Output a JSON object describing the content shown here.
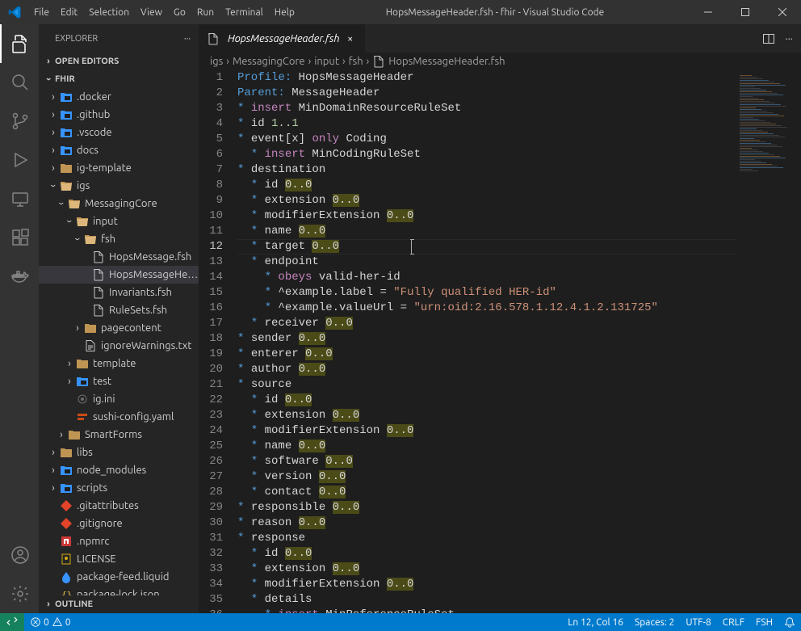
{
  "menu": {
    "file": "File",
    "edit": "Edit",
    "selection": "Selection",
    "view": "View",
    "go": "Go",
    "run": "Run",
    "terminal": "Terminal",
    "help": "Help"
  },
  "window_title": "HopsMessageHeader.fsh - fhir - Visual Studio Code",
  "explorer": {
    "title": "EXPLORER",
    "open_editors": "OPEN EDITORS",
    "root_folder": "FHIR",
    "outline": "OUTLINE",
    "tree": [
      {
        "label": ".docker",
        "depth": 1,
        "type": "folder-special",
        "collapsed": true
      },
      {
        "label": ".github",
        "depth": 1,
        "type": "folder-special",
        "collapsed": true
      },
      {
        "label": ".vscode",
        "depth": 1,
        "type": "folder-special",
        "collapsed": true
      },
      {
        "label": "docs",
        "depth": 1,
        "type": "folder-special",
        "collapsed": true
      },
      {
        "label": "ig-template",
        "depth": 1,
        "type": "folder",
        "collapsed": true
      },
      {
        "label": "igs",
        "depth": 1,
        "type": "folder",
        "collapsed": false
      },
      {
        "label": "MessagingCore",
        "depth": 2,
        "type": "folder",
        "collapsed": false
      },
      {
        "label": "input",
        "depth": 3,
        "type": "folder",
        "collapsed": false
      },
      {
        "label": "fsh",
        "depth": 4,
        "type": "folder",
        "collapsed": false
      },
      {
        "label": "HopsMessage.fsh",
        "depth": 5,
        "type": "file"
      },
      {
        "label": "HopsMessageHea...",
        "depth": 5,
        "type": "file",
        "selected": true
      },
      {
        "label": "Invariants.fsh",
        "depth": 5,
        "type": "file"
      },
      {
        "label": "RuleSets.fsh",
        "depth": 5,
        "type": "file"
      },
      {
        "label": "pagecontent",
        "depth": 4,
        "type": "folder",
        "collapsed": true
      },
      {
        "label": "ignoreWarnings.txt",
        "depth": 4,
        "type": "file-txt"
      },
      {
        "label": "template",
        "depth": 3,
        "type": "folder",
        "collapsed": true
      },
      {
        "label": "test",
        "depth": 3,
        "type": "folder-special",
        "collapsed": true
      },
      {
        "label": "ig.ini",
        "depth": 3,
        "type": "file-cog"
      },
      {
        "label": "sushi-config.yaml",
        "depth": 3,
        "type": "file-yaml"
      },
      {
        "label": "SmartForms",
        "depth": 2,
        "type": "folder",
        "collapsed": true
      },
      {
        "label": "libs",
        "depth": 1,
        "type": "folder",
        "collapsed": true
      },
      {
        "label": "node_modules",
        "depth": 1,
        "type": "folder-special",
        "collapsed": true
      },
      {
        "label": "scripts",
        "depth": 1,
        "type": "folder-special",
        "collapsed": true
      },
      {
        "label": ".gitattributes",
        "depth": 1,
        "type": "file-git"
      },
      {
        "label": ".gitignore",
        "depth": 1,
        "type": "file-git"
      },
      {
        "label": ".npmrc",
        "depth": 1,
        "type": "file-npm"
      },
      {
        "label": "LICENSE",
        "depth": 1,
        "type": "file-cert"
      },
      {
        "label": "package-feed.liquid",
        "depth": 1,
        "type": "file-liquid"
      },
      {
        "label": "package-lock.json",
        "depth": 1,
        "type": "file-json"
      }
    ]
  },
  "tab": {
    "label": "HopsMessageHeader.fsh"
  },
  "breadcrumbs": [
    "igs",
    "MessagingCore",
    "input",
    "fsh",
    "HopsMessageHeader.fsh"
  ],
  "editor": {
    "current_line": 12,
    "total_lines": 36
  },
  "status": {
    "errors": "0",
    "warnings": "0",
    "ln_col": "Ln 12, Col 16",
    "spaces": "Spaces: 2",
    "encoding": "UTF-8",
    "eol": "CRLF",
    "lang": "FSH"
  },
  "tokens": {
    "profile_kw": "Profile:",
    "profile_val": " HopsMessageHeader",
    "parent_kw": "Parent:",
    "parent_val": " MessageHeader",
    "insert": "insert",
    "min_rs": " MinDomainResourceRuleSet",
    "id": "id ",
    "id_card": "1..1",
    "event": "event[x] ",
    "only": "only",
    "coding": " Coding",
    "min_coding": " MinCodingRuleSet",
    "destination": "destination",
    "card00": "0..0",
    "extension": "extension ",
    "modext": "modifierExtension ",
    "name": "name ",
    "target": "target ",
    "endpoint": "endpoint",
    "obeys": "obeys",
    "valid_her": " valid-her-id",
    "ex_label_key": "^example.label",
    "eq": " = ",
    "full_her": "\"Fully qualified HER-id\"",
    "ex_val_key": "^example.valueUrl",
    "urn": "\"urn:oid:2.16.578.1.12.4.1.2.131725\"",
    "receiver": "receiver ",
    "sender": "sender ",
    "enterer": "enterer ",
    "author": "author ",
    "source": "source",
    "software": "software ",
    "version": "version ",
    "contact": "contact ",
    "responsible": "responsible ",
    "reason": "reason ",
    "response": "response",
    "details": "details",
    "min_ref_rs": " MinReferenceRuleSet"
  }
}
